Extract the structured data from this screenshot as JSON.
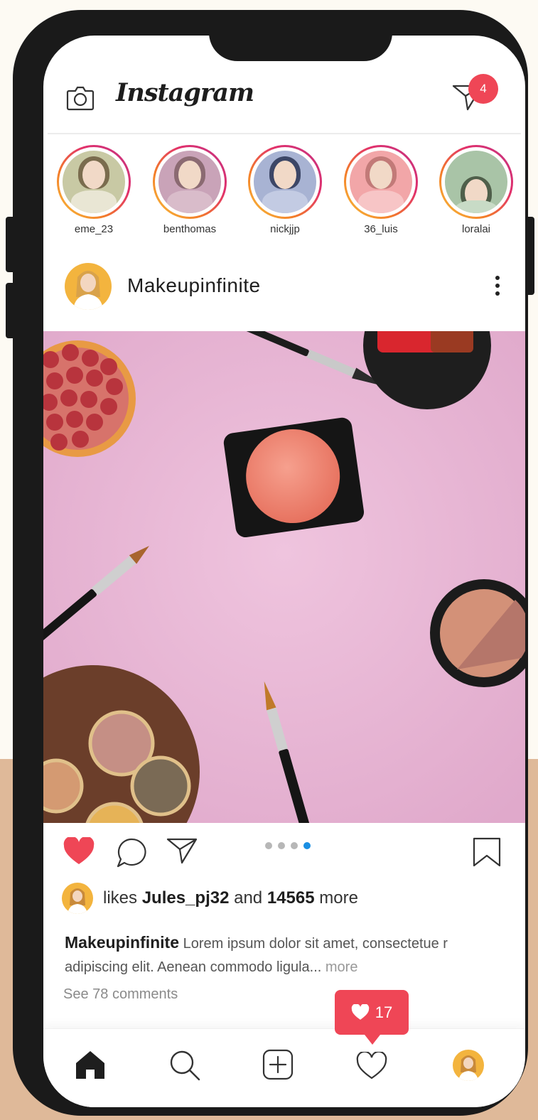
{
  "header": {
    "logo_text": "Instagram",
    "notification_count": "4"
  },
  "stories": [
    {
      "username": "eme_23",
      "bg": "#c8c9a4"
    },
    {
      "username": "benthomas",
      "bg": "#c9a3b8"
    },
    {
      "username": "nickjjp",
      "bg": "#a8b3d3"
    },
    {
      "username": "36_luis",
      "bg": "#f2a6a8"
    },
    {
      "username": "loralai",
      "bg": "#a9c4a7"
    }
  ],
  "post": {
    "username": "Makeupinfinite",
    "carousel_pages": 4,
    "carousel_active_page": 4,
    "liked": true
  },
  "likes": {
    "prefix": "likes",
    "user": "Jules_pj32",
    "joiner": "and",
    "count": "14565",
    "suffix": "more"
  },
  "caption": {
    "username": "Makeupinfinite",
    "text": "Lorem ipsum dolor sit amet, consectetue r adipiscing elit. Aenean commodo ligula...",
    "more_label": "more"
  },
  "comments_label": "See 78 comments",
  "activity_popup": {
    "count": "17"
  },
  "colors": {
    "accent_red": "#ef4656",
    "active_dot": "#1a8fe3",
    "post_bg": "#e7b6d4"
  }
}
